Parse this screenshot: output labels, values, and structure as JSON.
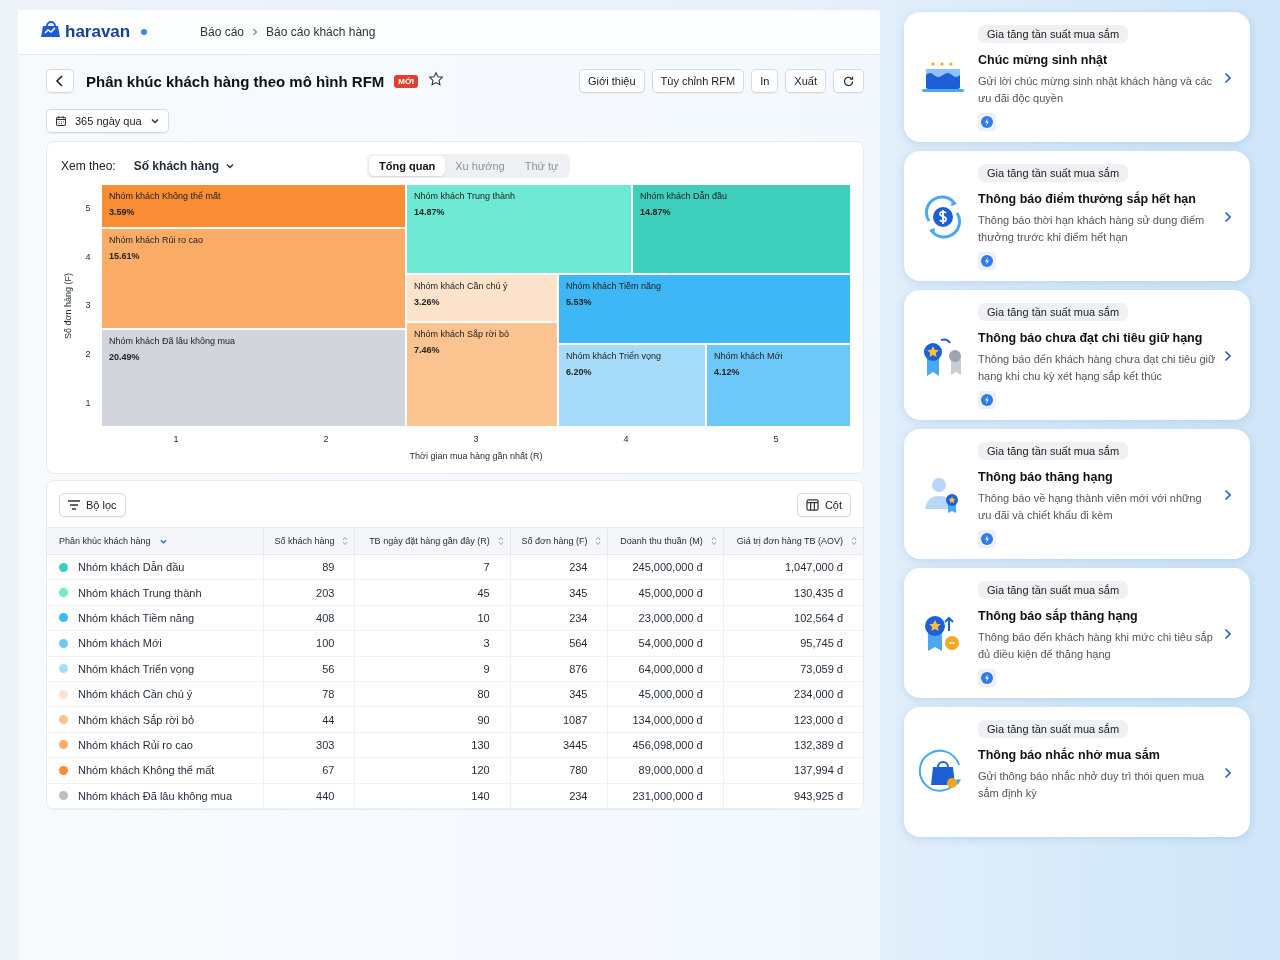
{
  "brand": {
    "name": "haravan"
  },
  "breadcrumb": [
    "Báo cáo",
    "Báo cáo khách hàng"
  ],
  "page": {
    "title": "Phân khúc khách hàng theo mô hình RFM",
    "badge": "MỚI",
    "starred": false
  },
  "actions": [
    "Giới thiệu",
    "Tùy chỉnh RFM",
    "In",
    "Xuất"
  ],
  "date_range": "365 ngày qua",
  "view": {
    "label": "Xem theo:",
    "value": "Số khách hàng",
    "tabs": [
      {
        "label": "Tổng quan",
        "selected": true
      },
      {
        "label": "Xu hướng",
        "selected": false
      },
      {
        "label": "Thứ tự",
        "selected": false
      }
    ]
  },
  "rfm_map": {
    "y_title": "Số đơn hàng (F)",
    "x_title": "Thời gian mua hàng gần nhất (R)",
    "y_ticks": [
      "5",
      "4",
      "3",
      "2",
      "1"
    ],
    "x_ticks": [
      "1",
      "2",
      "3",
      "4",
      "5"
    ],
    "segments": [
      {
        "name": "Nhóm khách Không thể mất",
        "share": "3.59%",
        "color": "#f88d35"
      },
      {
        "name": "Nhóm khách Rủi ro cao",
        "share": "15.61%",
        "color": "#fbad68"
      },
      {
        "name": "Nhóm khách Đã lâu không mua",
        "share": "20.49%",
        "color": "#d2d5dc"
      },
      {
        "name": "Nhóm khách Trung thành",
        "share": "14.87%",
        "color": "#6ee9d4"
      },
      {
        "name": "Nhóm khách Dẫn đầu",
        "share": "14.87%",
        "color": "#3ecfbc"
      },
      {
        "name": "Nhóm khách Cần chú ý",
        "share": "3.26%",
        "color": "#fde3cc"
      },
      {
        "name": "Nhóm khách Sắp rời bỏ",
        "share": "7.46%",
        "color": "#fbc38f"
      },
      {
        "name": "Nhóm khách Tiềm năng",
        "share": "5.53%",
        "color": "#3db7f5"
      },
      {
        "name": "Nhóm khách Triển vọng",
        "share": "6.20%",
        "color": "#a6dcfa"
      },
      {
        "name": "Nhóm khách Mới",
        "share": "4.12%",
        "color": "#6cc8f8"
      }
    ]
  },
  "filter_button": "Bộ lọc",
  "columns_button": "Cột",
  "table": {
    "columns": [
      "Phân khúc khách hàng",
      "Số khách hàng",
      "TB ngày đặt hàng gần đây (R)",
      "Số đơn hàng (F)",
      "Doanh thu thuần (M)",
      "Giá trị đơn hàng TB (AOV)"
    ],
    "rows": [
      {
        "color": "#3ecfbc",
        "cells": [
          "Nhóm khách Dẫn đầu",
          "89",
          "7",
          "234",
          "245,000,000 đ",
          "1,047,000 đ"
        ]
      },
      {
        "color": "#6ee9d4",
        "cells": [
          "Nhóm khách Trung thành",
          "203",
          "45",
          "345",
          "45,000,000 đ",
          "130,435 đ"
        ]
      },
      {
        "color": "#3db7f5",
        "cells": [
          "Nhóm khách Tiềm năng",
          "408",
          "10",
          "234",
          "23,000,000 đ",
          "102,564 đ"
        ]
      },
      {
        "color": "#6cc8f8",
        "cells": [
          "Nhóm khách Mới",
          "100",
          "3",
          "564",
          "54,000,000 đ",
          "95,745 đ"
        ]
      },
      {
        "color": "#a6dcfa",
        "cells": [
          "Nhóm khách Triển vọng",
          "56",
          "9",
          "876",
          "64,000,000 đ",
          "73,059 đ"
        ]
      },
      {
        "color": "#fde3cc",
        "cells": [
          "Nhóm khách Cần chú ý",
          "78",
          "80",
          "345",
          "45,000,000 đ",
          "234,000 đ"
        ]
      },
      {
        "color": "#fbc38f",
        "cells": [
          "Nhóm khách Sắp rời bỏ",
          "44",
          "90",
          "1087",
          "134,000,000 đ",
          "123,000 đ"
        ]
      },
      {
        "color": "#fbad68",
        "cells": [
          "Nhóm khách Rủi ro cao",
          "303",
          "130",
          "3445",
          "456,098,000 đ",
          "132,389 đ"
        ]
      },
      {
        "color": "#f88d35",
        "cells": [
          "Nhóm khách Không thể mất",
          "67",
          "120",
          "780",
          "89,000,000 đ",
          "137,994 đ"
        ]
      },
      {
        "color": "#b9bcc4",
        "cells": [
          "Nhóm khách Đã lâu không mua",
          "440",
          "140",
          "234",
          "231,000,000 đ",
          "943,925 đ"
        ]
      }
    ]
  },
  "campaigns": [
    {
      "tag": "Gia tăng tần suất mua sắm",
      "title": "Chúc mừng sinh nhật",
      "description": "Gửi lời chúc mừng sinh nhật khách hàng và các ưu đãi độc quyền",
      "kind": "cake",
      "badge": true
    },
    {
      "tag": "Gia tăng tần suất mua sắm",
      "title": "Thông báo điểm thưởng sắp hết hạn",
      "description": "Thông báo thời hạn khách hàng sử dung điểm thưởng trước khi điểm hết hạn",
      "kind": "coin",
      "badge": true
    },
    {
      "tag": "Gia tăng tần suất mua sắm",
      "title": "Thông báo chưa đạt chi tiêu giữ hạng",
      "description": "Thông báo đến khách hàng chưa đạt chi tiêu giữ hạng khi chu kỳ xét hạng sắp kết thúc",
      "kind": "medals",
      "badge": true
    },
    {
      "tag": "Gia tăng tần suất mua sắm",
      "title": "Thông báo thăng hạng",
      "description": "Thông báo về hạng thành viên mới với những ưu đãi và chiết khấu đi kèm",
      "kind": "user",
      "badge": true
    },
    {
      "tag": "Gia tăng tần suất mua sắm",
      "title": "Thông báo sắp thăng hạng",
      "description": "Thông báo đến khách hàng khi mức chi tiêu sắp đủ điều kiện để thăng hạng",
      "kind": "medal-up",
      "badge": true
    },
    {
      "tag": "Gia tăng tần suất mua sắm",
      "title": "Thông báo nhắc nhở mua sắm",
      "description": "Gửi thông báo nhắc nhở duy trì thói quen mua sắm định kỳ",
      "kind": "bag",
      "badge": false
    }
  ]
}
